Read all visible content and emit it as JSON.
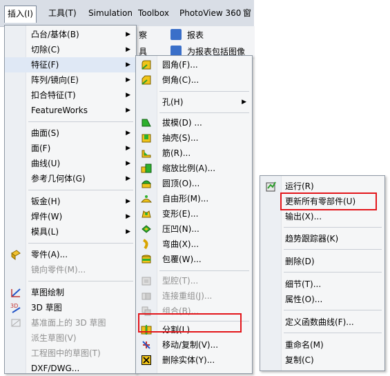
{
  "menubar": {
    "items": [
      "插入(I)",
      "工具(T)",
      "Simulation",
      "Toolbox",
      "PhotoView 360",
      "窗"
    ]
  },
  "peek": {
    "a": "察",
    "b": "报表",
    "c": "具",
    "d": "为报表包括图像"
  },
  "insert_menu": {
    "items": [
      {
        "label": "凸台/基体(B)",
        "arrow": "▶"
      },
      {
        "label": "切除(C)",
        "arrow": "▶"
      },
      {
        "label": "特征(F)",
        "arrow": "▶"
      },
      {
        "label": "阵列/镜向(E)",
        "arrow": "▶"
      },
      {
        "label": "扣合特征(T)",
        "arrow": "▶"
      },
      {
        "label": "FeatureWorks",
        "arrow": "▶"
      },
      {
        "label": "曲面(S)",
        "arrow": "▶"
      },
      {
        "label": "面(F)",
        "arrow": "▶"
      },
      {
        "label": "曲线(U)",
        "arrow": "▶"
      },
      {
        "label": "参考几何体(G)",
        "arrow": "▶"
      },
      {
        "label": "钣金(H)",
        "arrow": "▶"
      },
      {
        "label": "焊件(W)",
        "arrow": "▶"
      },
      {
        "label": "模具(L)",
        "arrow": "▶"
      },
      {
        "label": "零件(A)..."
      },
      {
        "label": "镜向零件(M)..."
      },
      {
        "label": "草图绘制"
      },
      {
        "label": "3D 草图"
      },
      {
        "label": "基准面上的 3D 草图"
      },
      {
        "label": "派生草图(V)"
      },
      {
        "label": "工程图中的草图(T)"
      },
      {
        "label": "DXF/DWG..."
      }
    ]
  },
  "feature_menu": {
    "items": [
      {
        "label": "圆角(F)..."
      },
      {
        "label": "倒角(C)..."
      },
      {
        "label": "孔(H)",
        "arrow": "▶"
      },
      {
        "label": "拔模(D) ..."
      },
      {
        "label": "抽壳(S)..."
      },
      {
        "label": "筋(R)..."
      },
      {
        "label": "缩放比例(A)..."
      },
      {
        "label": "圆顶(O)..."
      },
      {
        "label": "自由形(M)..."
      },
      {
        "label": "变形(E)..."
      },
      {
        "label": "压凹(N)..."
      },
      {
        "label": "弯曲(X)..."
      },
      {
        "label": "包覆(W)..."
      },
      {
        "label": "型腔(T)..."
      },
      {
        "label": "连接重组(J)..."
      },
      {
        "label": "组合(B)..."
      },
      {
        "label": "分割(L)..."
      },
      {
        "label": "移动/复制(V)..."
      },
      {
        "label": "删除实体(Y)..."
      }
    ]
  },
  "context_menu": {
    "items": [
      {
        "label": "运行(R)"
      },
      {
        "label": "更新所有零部件(U)"
      },
      {
        "label": "输出(X)..."
      },
      {
        "label": "趋势跟踪器(K)"
      },
      {
        "label": "删除(D)"
      },
      {
        "label": "细节(T)..."
      },
      {
        "label": "属性(O)..."
      },
      {
        "label": "定义函数曲线(F)..."
      },
      {
        "label": "重命名(M)"
      },
      {
        "label": "复制(C)"
      }
    ]
  },
  "colors": {
    "highlight": "#e3151a",
    "menu_bg": "#f5f6f7"
  }
}
